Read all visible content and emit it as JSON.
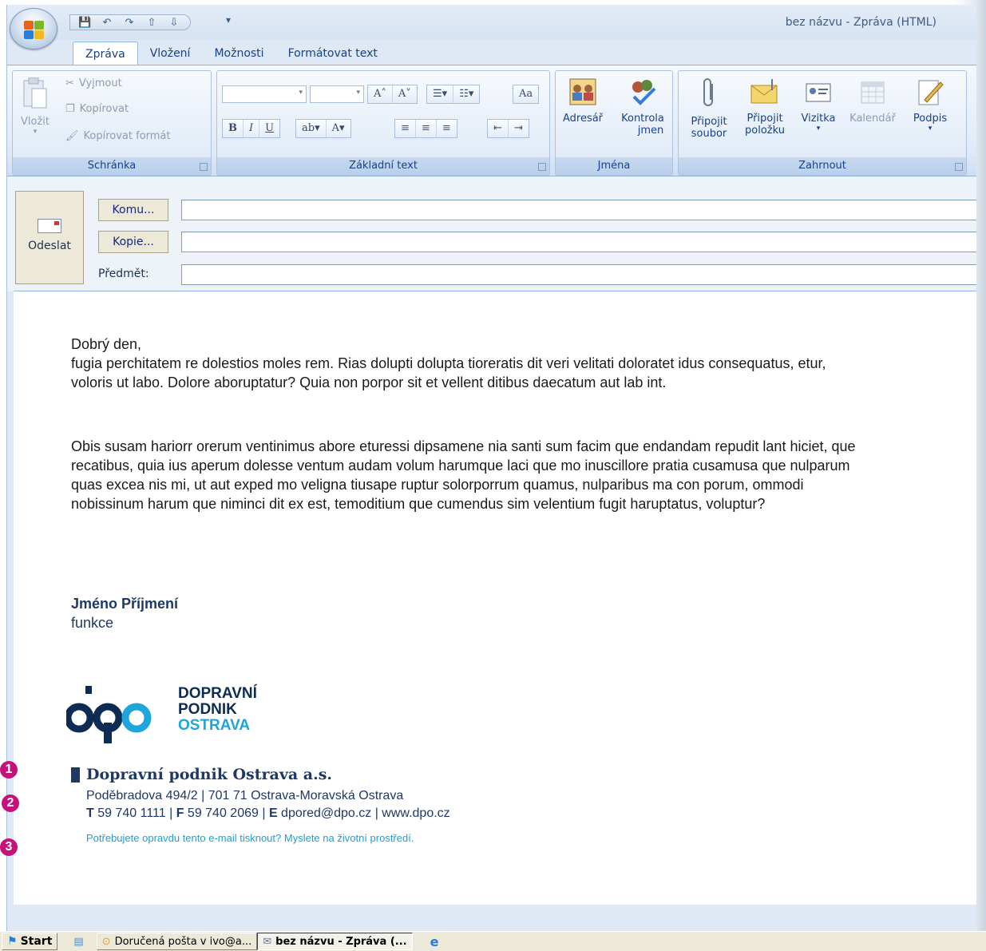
{
  "window": {
    "title": "bez názvu - Zpráva (HTML)"
  },
  "quick_access": {
    "items": [
      "save-icon",
      "undo-icon",
      "redo-icon",
      "up-icon",
      "down-icon"
    ],
    "more": "▾"
  },
  "tabs": [
    "Zpráva",
    "Vložení",
    "Možnosti",
    "Formátovat text"
  ],
  "ribbon": {
    "clipboard": {
      "label": "Schránka",
      "paste": "Vložit",
      "cut": "Vyjmout",
      "copy": "Kopírovat",
      "format_painter": "Kopírovat formát"
    },
    "basic_text": {
      "label": "Základní text",
      "bold": "B",
      "italic": "I",
      "underline": "U"
    },
    "names": {
      "label": "Jména",
      "address_book": "Adresář",
      "check_names_1": "Kontrola",
      "check_names_2": "jmen"
    },
    "include": {
      "label": "Zahrnout",
      "attach_file_1": "Připojit",
      "attach_file_2": "soubor",
      "attach_item_1": "Připojit",
      "attach_item_2": "položku",
      "card": "Vizitka",
      "calendar": "Kalendář",
      "signature": "Podpis"
    }
  },
  "compose": {
    "send": "Odeslat",
    "to": "Komu...",
    "cc": "Kopie...",
    "subject": "Předmět:",
    "to_value": "",
    "cc_value": "",
    "subject_value": ""
  },
  "message": {
    "greeting": "Dobrý den,",
    "para1": "fugia perchitatem re dolestios moles rem. Rias dolupti dolupta tioreratis dit veri velitati doloratet idus consequatus, etur, voloris ut labo. Dolore aboruptatur? Quia non porpor sit et vellent ditibus daecatum aut lab int.",
    "para2": "Obis susam hariorr orerum ventinimus abore eturessi dipsamene nia santi sum facim que endandam re­pudit lant hiciet, que recatibus, quia ius aperum dolesse ventum audam volum harumque laci que mo inuscillore pratia cusamusa que nulparum quas excea nis mi, ut aut exped mo veligna tiusape ruptur so­lorporrum quamus, nulparibus ma con porum, ommodi nobissinum harum que niminci dit ex est, temo­ditium que cumendus sim velentium fugit haruptatus, voluptur?",
    "sig_name": "Jméno Příjmení",
    "sig_role": "funkce"
  },
  "logo": {
    "line1": "DOPRAVNÍ",
    "line2": "PODNIK",
    "line3": "OSTRAVA",
    "color_dark": "#0d2c54",
    "color_light": "#1ea5dc"
  },
  "company": {
    "name": "Dopravní podnik Ostrava a.s.",
    "address": "Poděbradova 494/2  |  701 71 Ostrava-Moravská Ostrava",
    "t_label": "T",
    "t_value": " 59 740 1111  |  ",
    "f_label": "F",
    "f_value": " 59 740 2069  |  ",
    "e_label": "E",
    "e_value": " dpored@dpo.cz  |  www.dpo.cz",
    "eco_note": "Potřebujete opravdu tento e-mail tisknout? Myslete na životní prostředí."
  },
  "markers": [
    "1",
    "2",
    "3"
  ],
  "taskbar": {
    "start": "Start",
    "item1": "Doručená pošta v ivo@a...",
    "item2": "bez názvu - Zpráva (..."
  }
}
